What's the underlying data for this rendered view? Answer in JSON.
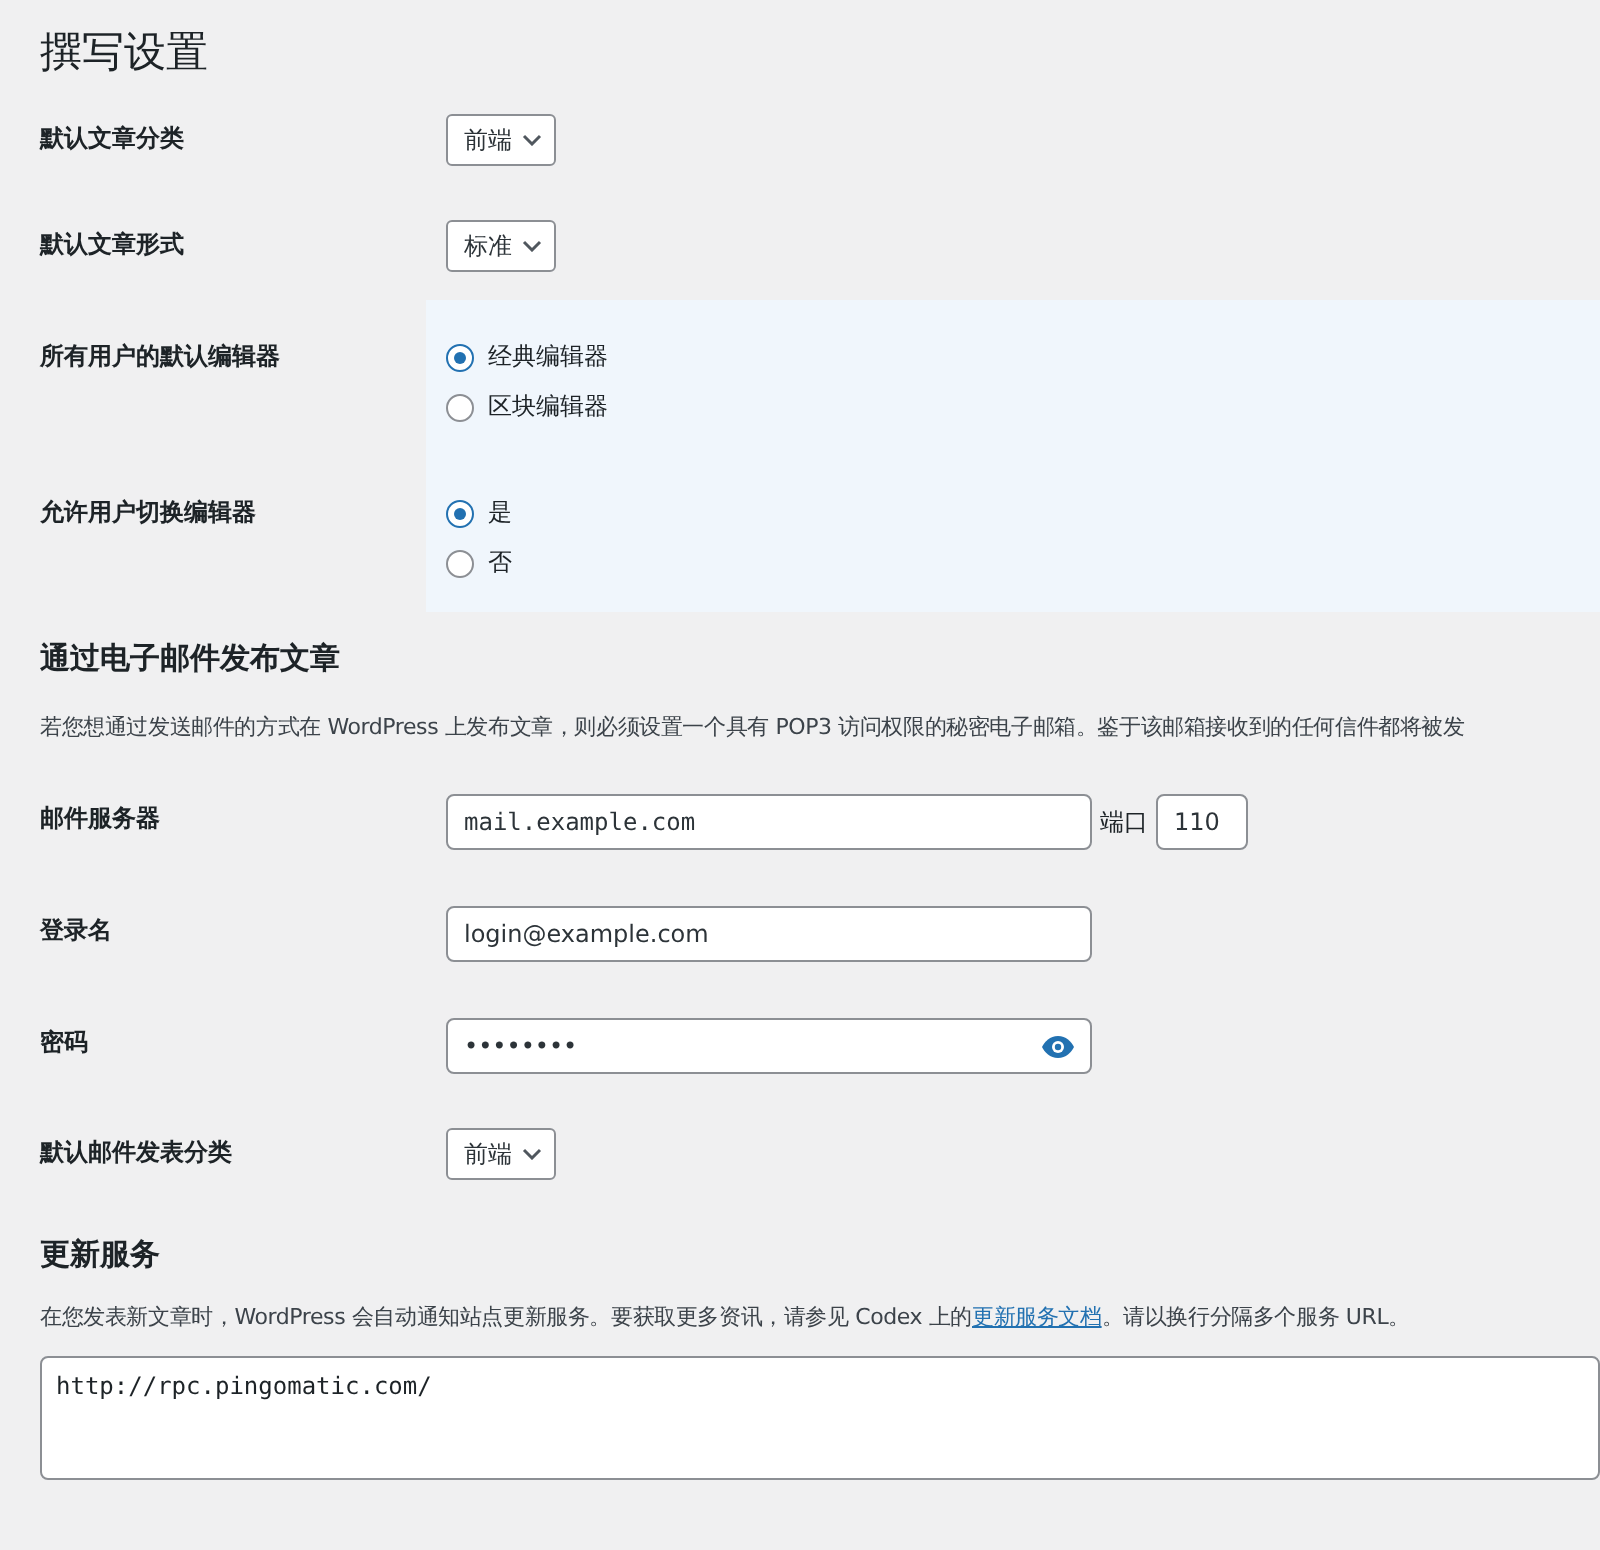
{
  "title": "撰写设置",
  "settings": [
    {
      "kind": "select",
      "label": "默认文章分类",
      "value": "前端"
    },
    {
      "kind": "select",
      "label": "默认文章形式",
      "value": "标准"
    },
    {
      "kind": "radio",
      "label": "所有用户的默认编辑器",
      "options": [
        {
          "label": "经典编辑器",
          "selected": true
        },
        {
          "label": "区块编辑器",
          "selected": false
        }
      ]
    },
    {
      "kind": "radio",
      "label": "允许用户切换编辑器",
      "options": [
        {
          "label": "是",
          "selected": true
        },
        {
          "label": "否",
          "selected": false
        }
      ]
    }
  ],
  "email": {
    "heading": "通过电子邮件发布文章",
    "description": "若您想通过发送邮件的方式在 WordPress 上发布文章，则必须设置一个具有 POP3 访问权限的秘密电子邮箱。鉴于该邮箱接收到的任何信件都将被发",
    "fields": [
      {
        "kind": "server",
        "label": "邮件服务器",
        "value": "mail.example.com",
        "port_label": "端口",
        "port": "110"
      },
      {
        "kind": "text",
        "label": "登录名",
        "value": "login@example.com"
      },
      {
        "kind": "password",
        "label": "密码",
        "value": "••••••••"
      },
      {
        "kind": "select",
        "label": "默认邮件发表分类",
        "value": "前端"
      }
    ]
  },
  "update": {
    "heading": "更新服务",
    "text_before": "在您发表新文章时，WordPress 会自动通知站点更新服务。要获取更多资讯，请参见 Codex 上的",
    "link": "更新服务文档",
    "text_after": "。请以换行分隔多个服务 URL。",
    "textarea": "http://rpc.pingomatic.com/"
  }
}
